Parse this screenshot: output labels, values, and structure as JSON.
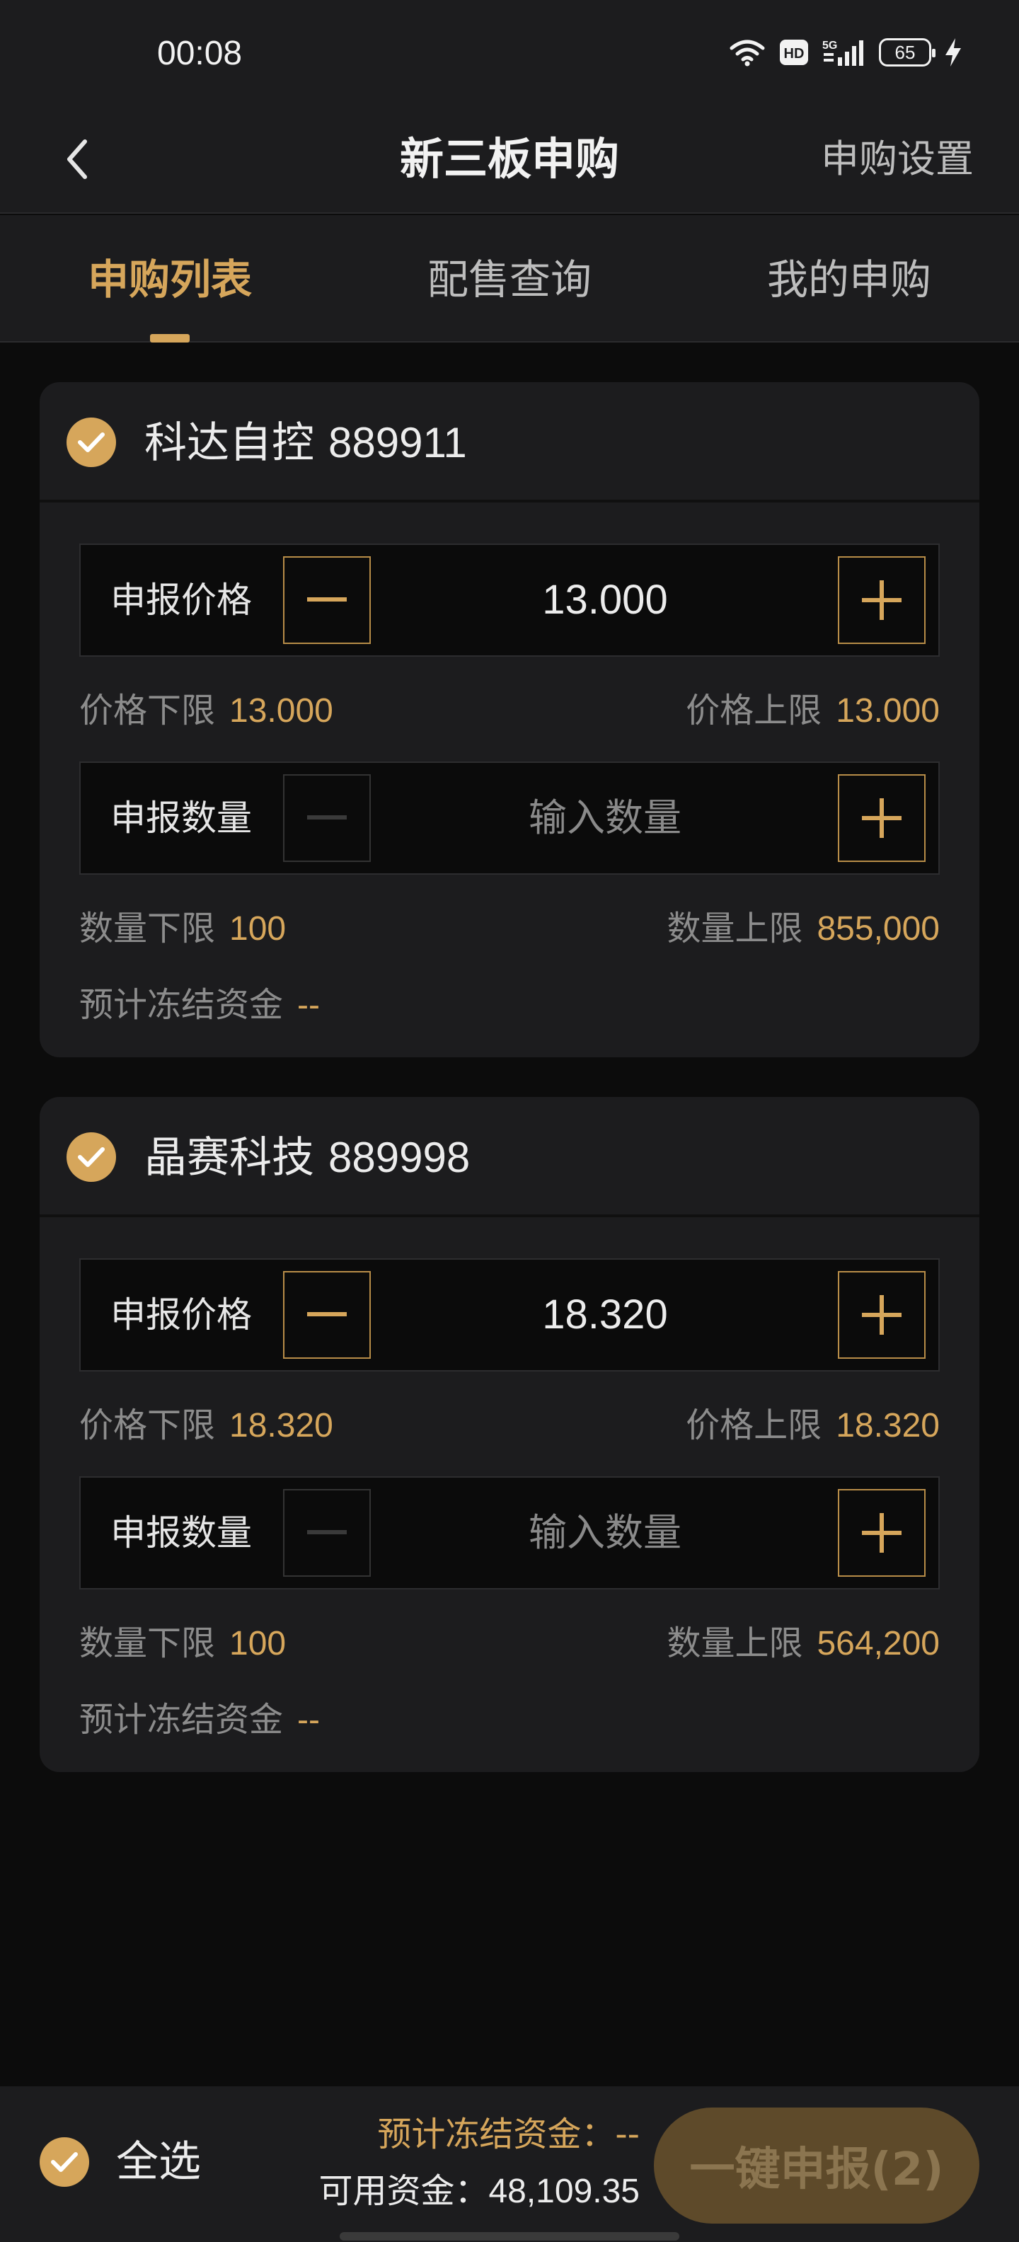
{
  "status_bar": {
    "time": "00:08",
    "battery": "65"
  },
  "nav": {
    "title": "新三板申购",
    "right_action": "申购设置"
  },
  "tabs": [
    {
      "label": "申购列表",
      "active": true
    },
    {
      "label": "配售查询",
      "active": false
    },
    {
      "label": "我的申购",
      "active": false
    }
  ],
  "stocks": [
    {
      "name": "科达自控",
      "code": "889911",
      "checked": true,
      "price_label": "申报价格",
      "price_value": "13.000",
      "price_low_label": "价格下限",
      "price_low": "13.000",
      "price_high_label": "价格上限",
      "price_high": "13.000",
      "qty_label": "申报数量",
      "qty_placeholder": "输入数量",
      "qty_low_label": "数量下限",
      "qty_low": "100",
      "qty_high_label": "数量上限",
      "qty_high": "855,000",
      "freeze_label": "预计冻结资金",
      "freeze_value": "--"
    },
    {
      "name": "晶赛科技",
      "code": "889998",
      "checked": true,
      "price_label": "申报价格",
      "price_value": "18.320",
      "price_low_label": "价格下限",
      "price_low": "18.320",
      "price_high_label": "价格上限",
      "price_high": "18.320",
      "qty_label": "申报数量",
      "qty_placeholder": "输入数量",
      "qty_low_label": "数量下限",
      "qty_low": "100",
      "qty_high_label": "数量上限",
      "qty_high": "564,200",
      "freeze_label": "预计冻结资金",
      "freeze_value": "--"
    }
  ],
  "bottom": {
    "select_all": "全选",
    "freeze_total_label": "预计冻结资金：",
    "freeze_total_value": "--",
    "available_label": "可用资金：",
    "available_value": "48,109.35",
    "submit_label": "一键申报(2)"
  },
  "colors": {
    "accent": "#d6a65b",
    "card": "#1c1c1e",
    "background": "#0c0c0c"
  }
}
